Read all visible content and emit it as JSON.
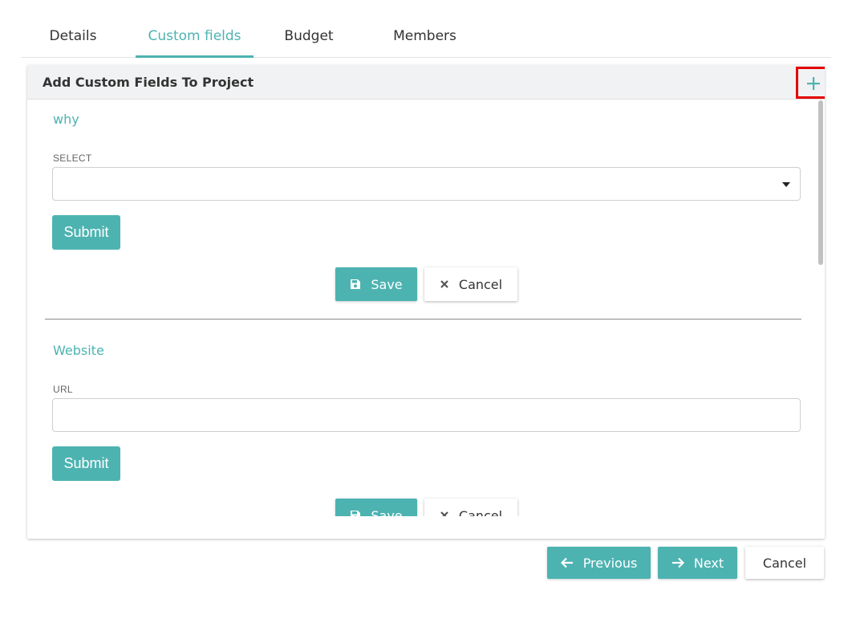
{
  "tabs": [
    {
      "label": "Details",
      "active": false
    },
    {
      "label": "Custom fields",
      "active": true
    },
    {
      "label": "Budget",
      "active": false
    },
    {
      "label": "Members",
      "active": false
    }
  ],
  "panel": {
    "title": "Add Custom Fields To Project",
    "add_icon": "plus-icon"
  },
  "fields": [
    {
      "title": "why",
      "label": "SELECT",
      "type": "select",
      "value": "",
      "submit_label": "Submit",
      "save_label": "Save",
      "cancel_label": "Cancel"
    },
    {
      "title": "Website",
      "label": "URL",
      "type": "text",
      "value": "",
      "submit_label": "Submit",
      "save_label": "Save",
      "cancel_label": "Cancel"
    }
  ],
  "footer": {
    "previous_label": "Previous",
    "next_label": "Next",
    "cancel_label": "Cancel"
  },
  "colors": {
    "accent": "#4db3b1",
    "highlight": "#e30000",
    "header_bg": "#f1f2f3"
  }
}
